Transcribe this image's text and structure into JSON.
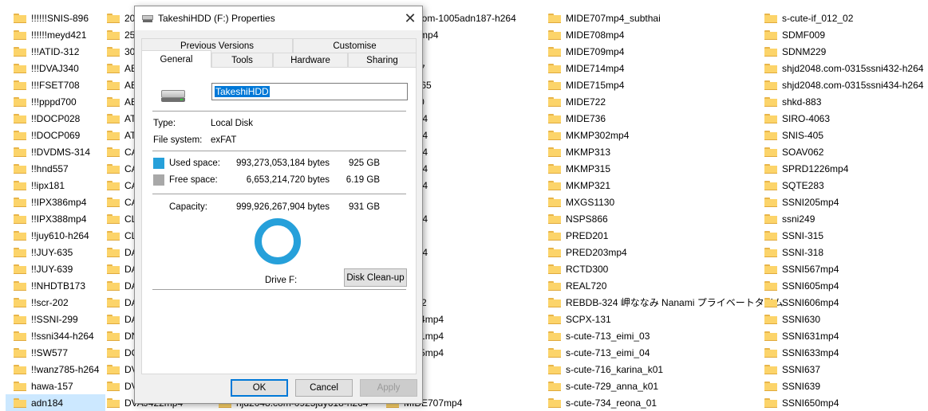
{
  "explorer": {
    "col1": [
      "!!!!!!SNIS-896",
      "!!!!!!meyd421",
      "!!!ATID-312",
      "!!!DVAJ340",
      "!!!FSET708",
      "!!!pppd700",
      "!!DOCP028",
      "!!DOCP069",
      "!!DVDMS-314",
      "!!hnd557",
      "!!ipx181",
      "!!IPX386mp4",
      "!!IPX388mp4",
      "!!juy610-h264",
      "!!JUY-635",
      "!!JUY-639",
      "!!NHDTB173",
      "!!scr-202",
      "!!SSNI-299",
      "!!ssni344-h264",
      "!!SW577",
      "!!wanz785-h264",
      "hawa-157",
      "adn184"
    ],
    "col2": [
      "200",
      "259",
      "302",
      "ABI",
      "ABI",
      "ABI",
      "ATI",
      "ATI",
      "CAV",
      "CAV",
      "CAV",
      "CAV",
      "CLU",
      "CLU",
      "DAS",
      "DAS",
      "DAS",
      "DAS",
      "DAS",
      "DNI",
      "DO",
      "DVA",
      "DVA",
      "DVAJ422mp4"
    ],
    "col3": [
      "hjd2048.com-0925juy618-h264"
    ],
    "col4": [
      "48.com-1005adn187-h264",
      "771mp4",
      "793",
      "5067",
      "7A465",
      "9110",
      "4mp4",
      "8mp4",
      "0mp4",
      "5mp4",
      "3mp4",
      "5",
      "7mp4",
      "a",
      "8mp4",
      "4",
      "8",
      "R042",
      "0524mp4",
      "0551mp4",
      "0555mp4",
      "214",
      "440",
      "MIDE707mp4"
    ],
    "col5": [
      "MIDE707mp4_subthai",
      "MIDE708mp4",
      "MIDE709mp4",
      "MIDE714mp4",
      "MIDE715mp4",
      "MIDE722",
      "MIDE736",
      "MKMP302mp4",
      "MKMP313",
      "MKMP315",
      "MKMP321",
      "MXGS1130",
      "NSPS866",
      "PRED201",
      "PRED203mp4",
      "RCTD300",
      "REAL720",
      "REBDB-324 岬ななみ Nanami プライベートタイム",
      "SCPX-131",
      "s-cute-713_eimi_03",
      "s-cute-713_eimi_04",
      "s-cute-716_karina_k01",
      "s-cute-729_anna_k01",
      "s-cute-734_reona_01"
    ],
    "col6": [
      "s-cute-if_012_02",
      "SDMF009",
      "SDNM229",
      "shjd2048.com-0315ssni432-h264",
      "shjd2048.com-0315ssni434-h264",
      "shkd-883",
      "SIRO-4063",
      "SNIS-405",
      "SOAV062",
      "SPRD1226mp4",
      "SQTE283",
      "SSNI205mp4",
      "ssni249",
      "SSNI-315",
      "SSNI-318",
      "SSNI567mp4",
      "SSNI605mp4",
      "SSNI606mp4",
      "SSNI630",
      "SSNI631mp4",
      "SSNI633mp4",
      "SSNI637",
      "SSNI639",
      "SSNI650mp4"
    ],
    "selected_item": "adn184"
  },
  "dialog": {
    "title": "TakeshiHDD (F:) Properties",
    "close_glyph": "✕",
    "tabs_row1": [
      "Previous Versions",
      "Customise"
    ],
    "tabs_row2": [
      "General",
      "Tools",
      "Hardware",
      "Sharing"
    ],
    "active_tab": "General",
    "drive_name": "TakeshiHDD",
    "type_label": "Type:",
    "type_value": "Local Disk",
    "fs_label": "File system:",
    "fs_value": "exFAT",
    "used_label": "Used space:",
    "used_bytes": "993,273,053,184 bytes",
    "used_gb": "925 GB",
    "free_label": "Free space:",
    "free_bytes": "6,653,214,720 bytes",
    "free_gb": "6.19 GB",
    "capacity_label": "Capacity:",
    "capacity_bytes": "999,926,267,904 bytes",
    "capacity_gb": "931 GB",
    "drive_caption": "Drive F:",
    "cleanup_label": "Disk Clean-up",
    "ok_label": "OK",
    "cancel_label": "Cancel",
    "apply_label": "Apply",
    "used_fraction": 0.9933,
    "colors": {
      "used": "#26a0da",
      "free": "#a8a8a8",
      "selection": "#0078d7"
    }
  }
}
